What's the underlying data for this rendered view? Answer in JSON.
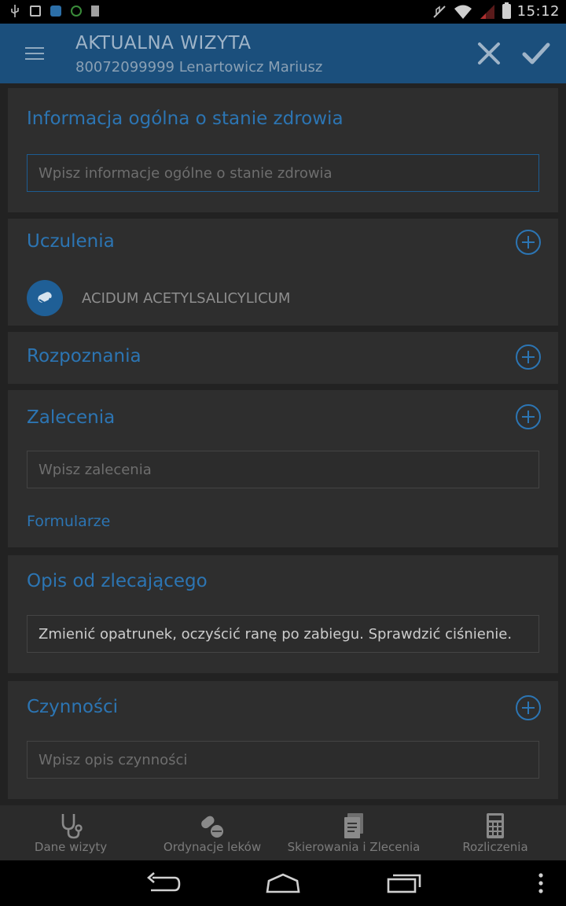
{
  "status_bar": {
    "time": "15:12"
  },
  "app_bar": {
    "title": "AKTUALNA WIZYTA",
    "subtitle": "80072099999 Lenartowicz Mariusz"
  },
  "sections": {
    "general": {
      "title": "Informacja ogólna o stanie zdrowia",
      "placeholder": "Wpisz informacje ogólne o stanie zdrowia"
    },
    "allergies": {
      "title": "Uczulenia",
      "items": [
        "ACIDUM ACETYLSALICYLICUM"
      ]
    },
    "diagnoses": {
      "title": "Rozpoznania"
    },
    "recommendations": {
      "title": "Zalecenia",
      "placeholder": "Wpisz zalecenia",
      "link": "Formularze"
    },
    "orderer": {
      "title": "Opis od zlecającego",
      "value": "Zmienić opatrunek, oczyścić ranę po zabiegu. Sprawdzić ciśnienie."
    },
    "activities": {
      "title": "Czynności",
      "placeholder": "Wpisz opis czynności"
    }
  },
  "bottom_tabs": [
    {
      "label": "Dane wizyty",
      "icon": "stethoscope-icon"
    },
    {
      "label": "Ordynacje leków",
      "icon": "pills-icon"
    },
    {
      "label": "Skierowania i Zlecenia",
      "icon": "documents-icon"
    },
    {
      "label": "Rozliczenia",
      "icon": "calculator-icon"
    }
  ],
  "colors": {
    "accent": "#2c75b3",
    "app_bar": "#1b4f7c",
    "card": "#2e2e2e",
    "background": "#222222"
  }
}
